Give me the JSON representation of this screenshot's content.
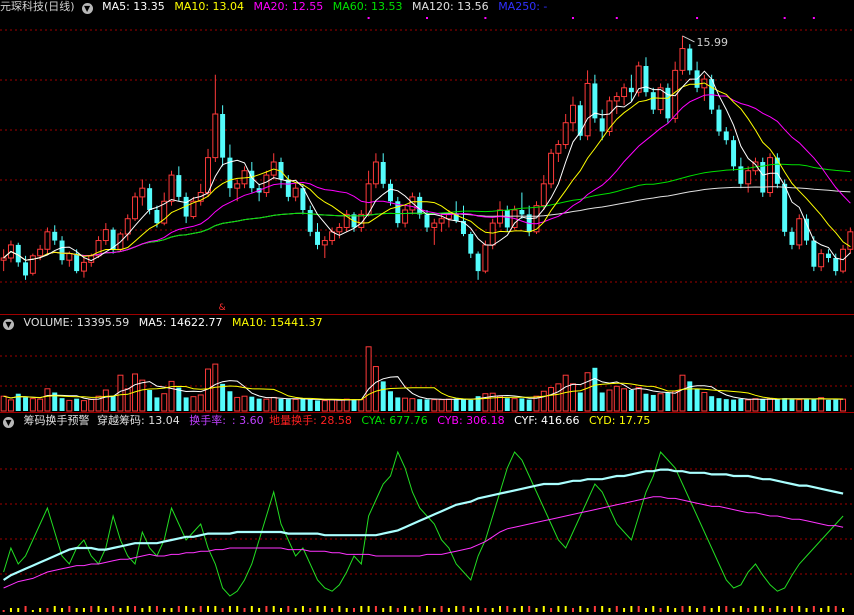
{
  "colors": {
    "up": "#ff3a3a",
    "down": "#54fcfc",
    "ma5": "#ffffff",
    "ma10": "#ffff00",
    "ma20": "#ff00ff",
    "ma60": "#00e000",
    "ma120": "#e0e0e0",
    "ma250": "#2020ff",
    "grid": "#a00000"
  },
  "price_panel": {
    "title": "元琛科技(日线)",
    "ma5_label": "MA5: 13.35",
    "ma10_label": "MA10: 13.04",
    "ma20_label": "MA20: 12.55",
    "ma60_label": "MA60: 13.53",
    "ma120_label": "MA120: 13.56",
    "ma250_label": "MA250: -",
    "high_marker": "15.99",
    "collapse_icon": "chevron-down-icon"
  },
  "volume_panel": {
    "volume_label": "VOLUME: 13395.59",
    "ma5_label": "MA5: 14622.77",
    "ma10_label": "MA10: 15441.37"
  },
  "indicator_panel": {
    "name": "筹码换手预警",
    "cross_label": "穿越筹码: 13.04",
    "turnover_label": "换手率:",
    "turnover_value": ": 3.60",
    "low_turnover_label": "地量换手: 28.58",
    "cya_label": "CYA: 677.76",
    "cyb_label": "CYB: 306.18",
    "cyf_label": "CYF: 416.66",
    "cyd_label": "CYD: 17.75"
  },
  "chart_data": {
    "type": "candlestick",
    "series_price_y_range": [
      9.8,
      16.4
    ],
    "ohlc": [
      [
        10.85,
        11.1,
        10.6,
        10.9
      ],
      [
        10.9,
        11.3,
        10.8,
        11.2
      ],
      [
        11.2,
        11.25,
        10.7,
        10.8
      ],
      [
        10.8,
        10.95,
        10.4,
        10.5
      ],
      [
        10.55,
        11.0,
        10.5,
        10.95
      ],
      [
        10.95,
        11.2,
        10.85,
        11.1
      ],
      [
        11.1,
        11.6,
        11.0,
        11.5
      ],
      [
        11.5,
        11.65,
        11.2,
        11.3
      ],
      [
        11.3,
        11.4,
        10.75,
        10.85
      ],
      [
        10.85,
        11.05,
        10.7,
        11.0
      ],
      [
        11.0,
        11.1,
        10.55,
        10.6
      ],
      [
        10.6,
        10.9,
        10.45,
        10.8
      ],
      [
        10.8,
        11.0,
        10.7,
        10.95
      ],
      [
        10.95,
        11.4,
        10.9,
        11.3
      ],
      [
        11.3,
        11.7,
        11.2,
        11.55
      ],
      [
        11.55,
        11.6,
        11.0,
        11.1
      ],
      [
        11.1,
        11.5,
        11.05,
        11.45
      ],
      [
        11.45,
        11.9,
        11.3,
        11.8
      ],
      [
        11.8,
        12.4,
        11.75,
        12.3
      ],
      [
        12.3,
        12.7,
        12.1,
        12.5
      ],
      [
        12.5,
        12.6,
        11.9,
        12.0
      ],
      [
        12.0,
        12.1,
        11.6,
        11.7
      ],
      [
        11.7,
        12.4,
        11.65,
        12.2
      ],
      [
        12.2,
        12.9,
        12.1,
        12.8
      ],
      [
        12.8,
        13.0,
        12.2,
        12.3
      ],
      [
        12.3,
        12.4,
        11.7,
        11.85
      ],
      [
        11.85,
        12.3,
        11.8,
        12.2
      ],
      [
        12.2,
        12.6,
        12.1,
        12.4
      ],
      [
        12.4,
        13.4,
        12.3,
        13.2
      ],
      [
        13.2,
        15.1,
        13.1,
        14.2
      ],
      [
        14.2,
        14.4,
        13.0,
        13.2
      ],
      [
        13.2,
        13.5,
        12.3,
        12.5
      ],
      [
        12.5,
        12.7,
        12.2,
        12.6
      ],
      [
        12.6,
        13.0,
        12.5,
        12.9
      ],
      [
        12.9,
        13.1,
        12.4,
        12.5
      ],
      [
        12.5,
        12.6,
        12.2,
        12.4
      ],
      [
        12.4,
        12.9,
        12.3,
        12.8
      ],
      [
        12.8,
        13.3,
        12.7,
        13.1
      ],
      [
        13.1,
        13.2,
        12.5,
        12.7
      ],
      [
        12.7,
        12.8,
        12.2,
        12.3
      ],
      [
        12.3,
        12.6,
        12.2,
        12.5
      ],
      [
        12.5,
        12.6,
        11.9,
        12.0
      ],
      [
        12.0,
        12.1,
        11.4,
        11.5
      ],
      [
        11.5,
        11.7,
        11.1,
        11.2
      ],
      [
        11.2,
        11.4,
        10.9,
        11.3
      ],
      [
        11.3,
        11.6,
        11.2,
        11.5
      ],
      [
        11.5,
        11.7,
        11.35,
        11.6
      ],
      [
        11.6,
        12.0,
        11.5,
        11.9
      ],
      [
        11.9,
        11.95,
        11.5,
        11.6
      ],
      [
        11.6,
        12.0,
        11.5,
        11.9
      ],
      [
        11.9,
        12.9,
        11.85,
        12.6
      ],
      [
        12.6,
        13.3,
        12.5,
        13.1
      ],
      [
        13.1,
        13.3,
        12.5,
        12.6
      ],
      [
        12.6,
        12.7,
        12.1,
        12.2
      ],
      [
        12.2,
        12.3,
        11.6,
        11.7
      ],
      [
        11.7,
        12.1,
        11.6,
        12.0
      ],
      [
        12.0,
        12.4,
        11.9,
        12.3
      ],
      [
        12.3,
        12.4,
        11.8,
        11.9
      ],
      [
        11.9,
        12.0,
        11.5,
        11.6
      ],
      [
        11.6,
        11.8,
        11.2,
        11.7
      ],
      [
        11.7,
        11.9,
        11.5,
        11.8
      ],
      [
        11.8,
        12.0,
        11.6,
        11.9
      ],
      [
        11.9,
        12.2,
        11.7,
        11.75
      ],
      [
        11.75,
        12.1,
        11.4,
        11.45
      ],
      [
        11.45,
        11.5,
        10.9,
        11.0
      ],
      [
        11.0,
        11.05,
        10.4,
        10.6
      ],
      [
        10.6,
        11.3,
        10.55,
        11.2
      ],
      [
        11.2,
        11.8,
        11.1,
        11.7
      ],
      [
        11.7,
        12.2,
        11.6,
        12.0
      ],
      [
        12.0,
        12.1,
        11.5,
        11.6
      ],
      [
        11.6,
        12.1,
        11.55,
        12.0
      ],
      [
        12.0,
        12.4,
        11.8,
        11.9
      ],
      [
        11.9,
        12.1,
        11.4,
        11.5
      ],
      [
        11.5,
        12.2,
        11.45,
        12.1
      ],
      [
        12.1,
        12.8,
        12.0,
        12.6
      ],
      [
        12.6,
        13.4,
        12.5,
        13.3
      ],
      [
        13.3,
        13.6,
        13.1,
        13.5
      ],
      [
        13.5,
        14.2,
        13.4,
        14.0
      ],
      [
        14.0,
        14.6,
        13.8,
        14.4
      ],
      [
        14.4,
        14.5,
        13.6,
        13.7
      ],
      [
        13.7,
        15.2,
        13.6,
        14.9
      ],
      [
        14.9,
        15.1,
        14.0,
        14.1
      ],
      [
        14.1,
        14.3,
        13.6,
        13.8
      ],
      [
        13.8,
        14.6,
        13.7,
        14.5
      ],
      [
        14.5,
        14.7,
        14.2,
        14.6
      ],
      [
        14.6,
        14.9,
        14.4,
        14.8
      ],
      [
        14.8,
        15.1,
        14.5,
        14.7
      ],
      [
        14.7,
        15.4,
        14.6,
        15.3
      ],
      [
        15.3,
        15.5,
        14.6,
        14.7
      ],
      [
        14.7,
        14.8,
        14.2,
        14.3
      ],
      [
        14.3,
        14.9,
        14.2,
        14.8
      ],
      [
        14.8,
        14.9,
        14.0,
        14.1
      ],
      [
        14.1,
        15.4,
        14.0,
        15.2
      ],
      [
        15.2,
        15.99,
        15.1,
        15.7
      ],
      [
        15.7,
        15.8,
        15.1,
        15.2
      ],
      [
        15.2,
        15.4,
        14.7,
        14.8
      ],
      [
        14.8,
        15.1,
        14.5,
        15.0
      ],
      [
        15.0,
        15.1,
        14.2,
        14.3
      ],
      [
        14.3,
        14.4,
        13.7,
        13.8
      ],
      [
        13.8,
        13.9,
        13.5,
        13.6
      ],
      [
        13.6,
        13.7,
        12.9,
        13.0
      ],
      [
        13.0,
        13.2,
        12.5,
        12.6
      ],
      [
        12.6,
        13.0,
        12.4,
        12.9
      ],
      [
        12.9,
        13.2,
        12.8,
        13.1
      ],
      [
        13.1,
        13.2,
        12.3,
        12.4
      ],
      [
        12.4,
        13.3,
        12.3,
        13.2
      ],
      [
        13.2,
        13.3,
        12.5,
        12.6
      ],
      [
        12.6,
        12.7,
        11.4,
        11.5
      ],
      [
        11.5,
        11.6,
        11.1,
        11.2
      ],
      [
        11.2,
        11.9,
        11.1,
        11.8
      ],
      [
        11.8,
        11.9,
        11.2,
        11.3
      ],
      [
        11.3,
        11.4,
        10.6,
        10.7
      ],
      [
        10.7,
        11.1,
        10.6,
        11.0
      ],
      [
        11.0,
        11.1,
        10.8,
        10.9
      ],
      [
        10.9,
        11.0,
        10.5,
        10.6
      ],
      [
        10.6,
        11.2,
        10.55,
        11.1
      ],
      [
        11.1,
        11.6,
        11.0,
        11.5
      ]
    ],
    "volume_y_range": [
      0,
      32000
    ],
    "volume": [
      6000,
      4500,
      7000,
      5500,
      5000,
      4800,
      9000,
      7500,
      5200,
      4300,
      5000,
      4200,
      4700,
      6000,
      8500,
      6200,
      14500,
      9000,
      15000,
      12500,
      8500,
      5500,
      7000,
      12000,
      9500,
      5500,
      5800,
      6500,
      17000,
      19000,
      11000,
      8000,
      5500,
      6000,
      5800,
      5000,
      4800,
      5500,
      4900,
      4800,
      4700,
      5000,
      4600,
      4300,
      4200,
      4500,
      4400,
      4800,
      4700,
      4600,
      26000,
      18000,
      12000,
      8000,
      5500,
      5200,
      5000,
      4800,
      4700,
      4600,
      4600,
      4800,
      5000,
      4800,
      4500,
      6000,
      7000,
      7200,
      6000,
      5200,
      5000,
      5100,
      4600,
      6000,
      8000,
      9500,
      11000,
      14500,
      11000,
      7500,
      15500,
      17500,
      7500,
      8500,
      10000,
      9000,
      8500,
      9500,
      7000,
      6500,
      7000,
      7500,
      8000,
      14500,
      12000,
      9000,
      7500,
      6000,
      5200,
      4800,
      4600,
      4900,
      4500,
      5000,
      4700,
      5000,
      4800,
      5200,
      5100,
      4600,
      5000,
      4700,
      5400,
      4500,
      4600,
      4800
    ],
    "cyf_y_range": [
      0,
      100
    ],
    "cyf": [
      10,
      12,
      14,
      15,
      16,
      18,
      20,
      21,
      22,
      23,
      24,
      24,
      25,
      25,
      26,
      27,
      28,
      28,
      29,
      30,
      31,
      30,
      30,
      31,
      31,
      32,
      32,
      33,
      33,
      34,
      34,
      35,
      35,
      35,
      35,
      35,
      35,
      35,
      35,
      34,
      34,
      34,
      33,
      33,
      33,
      32,
      32,
      31,
      31,
      31,
      31,
      30,
      30,
      30,
      30,
      30,
      30,
      30,
      31,
      31,
      31,
      32,
      33,
      34,
      35,
      37,
      39,
      42,
      45,
      47,
      48,
      49,
      50,
      51,
      52,
      53,
      54,
      55,
      56,
      57,
      58,
      59,
      60,
      61,
      62,
      63,
      64,
      65,
      66,
      67,
      67,
      66,
      66,
      65,
      64,
      63,
      62,
      61,
      61,
      60,
      59,
      58,
      57,
      57,
      56,
      55,
      55,
      54,
      53,
      53,
      52,
      51,
      50,
      49,
      49,
      48
    ],
    "cya": [
      15,
      18,
      20,
      22,
      24,
      26,
      28,
      30,
      32,
      34,
      35,
      35,
      35,
      34,
      34,
      35,
      36,
      37,
      38,
      38,
      38,
      38,
      39,
      40,
      41,
      42,
      42,
      43,
      44,
      44,
      44,
      44,
      45,
      45,
      45,
      45,
      45,
      45,
      45,
      44,
      44,
      44,
      44,
      44,
      43,
      43,
      43,
      43,
      43,
      43,
      43,
      43,
      44,
      45,
      46,
      48,
      50,
      52,
      54,
      56,
      58,
      60,
      62,
      63,
      64,
      66,
      67,
      68,
      69,
      70,
      71,
      72,
      73,
      74,
      75,
      75,
      75,
      76,
      77,
      77,
      78,
      78,
      78,
      79,
      80,
      80,
      81,
      82,
      83,
      83,
      84,
      84,
      83,
      83,
      82,
      82,
      82,
      81,
      81,
      81,
      80,
      80,
      80,
      79,
      78,
      78,
      77,
      76,
      75,
      74,
      74,
      73,
      72,
      71,
      70,
      69
    ],
    "turnover_line": [
      20,
      35,
      25,
      30,
      40,
      50,
      60,
      45,
      30,
      25,
      35,
      40,
      30,
      25,
      35,
      55,
      40,
      30,
      25,
      45,
      35,
      30,
      40,
      60,
      50,
      40,
      45,
      50,
      35,
      25,
      10,
      5,
      8,
      15,
      25,
      40,
      55,
      70,
      50,
      40,
      30,
      35,
      25,
      15,
      10,
      8,
      12,
      20,
      30,
      25,
      55,
      65,
      75,
      80,
      95,
      85,
      70,
      60,
      55,
      50,
      40,
      35,
      25,
      20,
      15,
      30,
      40,
      55,
      70,
      85,
      95,
      90,
      80,
      70,
      60,
      50,
      40,
      35,
      45,
      55,
      65,
      75,
      70,
      60,
      50,
      45,
      40,
      55,
      70,
      80,
      95,
      90,
      85,
      75,
      65,
      55,
      45,
      35,
      25,
      15,
      10,
      12,
      20,
      25,
      18,
      12,
      8,
      10,
      18,
      25,
      30,
      35,
      40,
      45,
      50,
      55
    ],
    "yellow_bars": [
      1,
      2,
      2,
      3,
      1,
      2,
      2,
      3,
      2,
      3,
      2,
      2,
      3,
      3,
      2,
      3,
      2,
      3,
      3,
      2,
      3,
      3,
      2,
      2,
      3,
      3,
      2,
      3,
      3,
      3,
      2,
      3,
      3,
      2,
      3,
      2,
      3,
      3,
      2,
      3,
      2,
      3,
      2,
      3,
      3,
      2,
      3,
      2,
      2,
      3,
      3,
      3,
      2,
      3,
      2,
      3,
      2,
      3,
      3,
      2,
      3,
      2,
      3,
      3,
      2,
      3,
      2,
      2,
      3,
      3,
      2,
      3,
      3,
      2,
      3,
      2,
      3,
      3,
      2,
      3,
      2,
      3,
      3,
      2,
      3,
      2,
      3,
      3,
      2,
      3,
      2,
      3,
      2,
      3,
      3,
      2,
      3,
      2,
      3,
      3,
      2,
      3,
      2,
      3,
      3,
      2,
      3,
      2,
      3,
      3,
      2,
      3,
      2,
      3,
      3,
      2
    ]
  }
}
